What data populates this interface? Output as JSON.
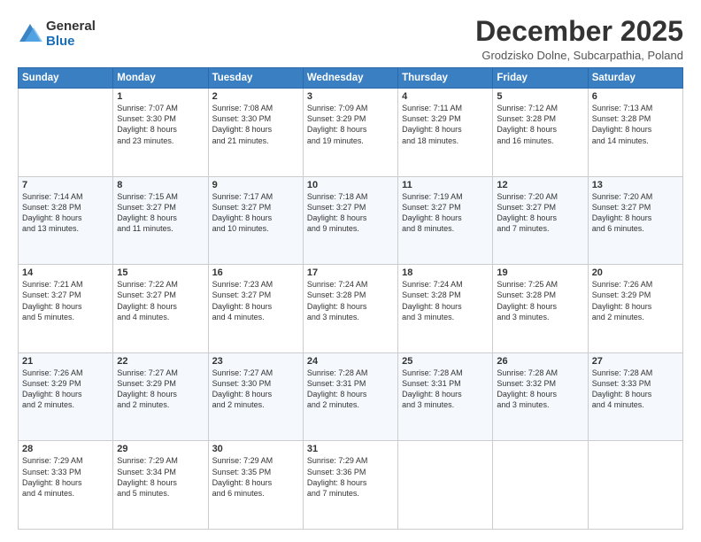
{
  "logo": {
    "general": "General",
    "blue": "Blue"
  },
  "header": {
    "month_title": "December 2025",
    "subtitle": "Grodzisko Dolne, Subcarpathia, Poland"
  },
  "days_of_week": [
    "Sunday",
    "Monday",
    "Tuesday",
    "Wednesday",
    "Thursday",
    "Friday",
    "Saturday"
  ],
  "weeks": [
    [
      {
        "day": "",
        "info": ""
      },
      {
        "day": "1",
        "info": "Sunrise: 7:07 AM\nSunset: 3:30 PM\nDaylight: 8 hours\nand 23 minutes."
      },
      {
        "day": "2",
        "info": "Sunrise: 7:08 AM\nSunset: 3:30 PM\nDaylight: 8 hours\nand 21 minutes."
      },
      {
        "day": "3",
        "info": "Sunrise: 7:09 AM\nSunset: 3:29 PM\nDaylight: 8 hours\nand 19 minutes."
      },
      {
        "day": "4",
        "info": "Sunrise: 7:11 AM\nSunset: 3:29 PM\nDaylight: 8 hours\nand 18 minutes."
      },
      {
        "day": "5",
        "info": "Sunrise: 7:12 AM\nSunset: 3:28 PM\nDaylight: 8 hours\nand 16 minutes."
      },
      {
        "day": "6",
        "info": "Sunrise: 7:13 AM\nSunset: 3:28 PM\nDaylight: 8 hours\nand 14 minutes."
      }
    ],
    [
      {
        "day": "7",
        "info": "Sunrise: 7:14 AM\nSunset: 3:28 PM\nDaylight: 8 hours\nand 13 minutes."
      },
      {
        "day": "8",
        "info": "Sunrise: 7:15 AM\nSunset: 3:27 PM\nDaylight: 8 hours\nand 11 minutes."
      },
      {
        "day": "9",
        "info": "Sunrise: 7:17 AM\nSunset: 3:27 PM\nDaylight: 8 hours\nand 10 minutes."
      },
      {
        "day": "10",
        "info": "Sunrise: 7:18 AM\nSunset: 3:27 PM\nDaylight: 8 hours\nand 9 minutes."
      },
      {
        "day": "11",
        "info": "Sunrise: 7:19 AM\nSunset: 3:27 PM\nDaylight: 8 hours\nand 8 minutes."
      },
      {
        "day": "12",
        "info": "Sunrise: 7:20 AM\nSunset: 3:27 PM\nDaylight: 8 hours\nand 7 minutes."
      },
      {
        "day": "13",
        "info": "Sunrise: 7:20 AM\nSunset: 3:27 PM\nDaylight: 8 hours\nand 6 minutes."
      }
    ],
    [
      {
        "day": "14",
        "info": "Sunrise: 7:21 AM\nSunset: 3:27 PM\nDaylight: 8 hours\nand 5 minutes."
      },
      {
        "day": "15",
        "info": "Sunrise: 7:22 AM\nSunset: 3:27 PM\nDaylight: 8 hours\nand 4 minutes."
      },
      {
        "day": "16",
        "info": "Sunrise: 7:23 AM\nSunset: 3:27 PM\nDaylight: 8 hours\nand 4 minutes."
      },
      {
        "day": "17",
        "info": "Sunrise: 7:24 AM\nSunset: 3:28 PM\nDaylight: 8 hours\nand 3 minutes."
      },
      {
        "day": "18",
        "info": "Sunrise: 7:24 AM\nSunset: 3:28 PM\nDaylight: 8 hours\nand 3 minutes."
      },
      {
        "day": "19",
        "info": "Sunrise: 7:25 AM\nSunset: 3:28 PM\nDaylight: 8 hours\nand 3 minutes."
      },
      {
        "day": "20",
        "info": "Sunrise: 7:26 AM\nSunset: 3:29 PM\nDaylight: 8 hours\nand 2 minutes."
      }
    ],
    [
      {
        "day": "21",
        "info": "Sunrise: 7:26 AM\nSunset: 3:29 PM\nDaylight: 8 hours\nand 2 minutes."
      },
      {
        "day": "22",
        "info": "Sunrise: 7:27 AM\nSunset: 3:29 PM\nDaylight: 8 hours\nand 2 minutes."
      },
      {
        "day": "23",
        "info": "Sunrise: 7:27 AM\nSunset: 3:30 PM\nDaylight: 8 hours\nand 2 minutes."
      },
      {
        "day": "24",
        "info": "Sunrise: 7:28 AM\nSunset: 3:31 PM\nDaylight: 8 hours\nand 2 minutes."
      },
      {
        "day": "25",
        "info": "Sunrise: 7:28 AM\nSunset: 3:31 PM\nDaylight: 8 hours\nand 3 minutes."
      },
      {
        "day": "26",
        "info": "Sunrise: 7:28 AM\nSunset: 3:32 PM\nDaylight: 8 hours\nand 3 minutes."
      },
      {
        "day": "27",
        "info": "Sunrise: 7:28 AM\nSunset: 3:33 PM\nDaylight: 8 hours\nand 4 minutes."
      }
    ],
    [
      {
        "day": "28",
        "info": "Sunrise: 7:29 AM\nSunset: 3:33 PM\nDaylight: 8 hours\nand 4 minutes."
      },
      {
        "day": "29",
        "info": "Sunrise: 7:29 AM\nSunset: 3:34 PM\nDaylight: 8 hours\nand 5 minutes."
      },
      {
        "day": "30",
        "info": "Sunrise: 7:29 AM\nSunset: 3:35 PM\nDaylight: 8 hours\nand 6 minutes."
      },
      {
        "day": "31",
        "info": "Sunrise: 7:29 AM\nSunset: 3:36 PM\nDaylight: 8 hours\nand 7 minutes."
      },
      {
        "day": "",
        "info": ""
      },
      {
        "day": "",
        "info": ""
      },
      {
        "day": "",
        "info": ""
      }
    ]
  ]
}
